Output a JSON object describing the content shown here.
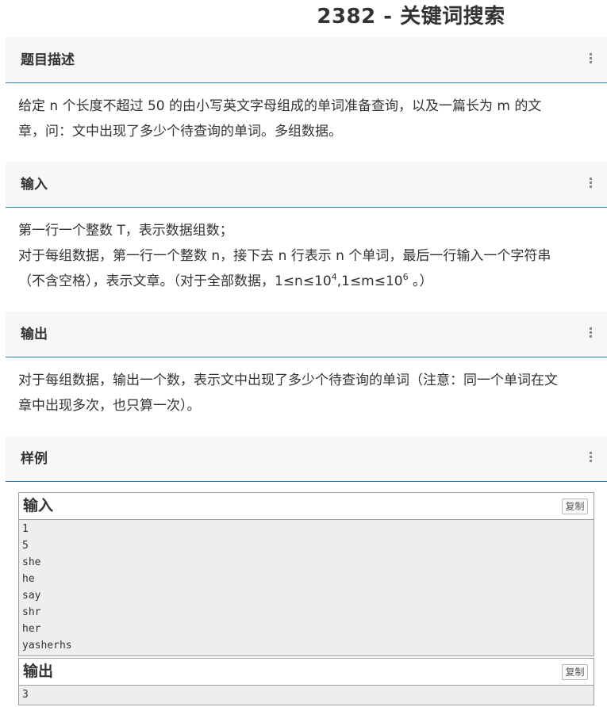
{
  "page": {
    "title": "2382 - 关键词搜索"
  },
  "sections": {
    "description": {
      "header": "题目描述",
      "lines": [
        "给定 n 个长度不超过 50 的由小写英文字母组成的单词准备查询，以及一篇长为 m 的文",
        "章，问：文中出现了多少个待查询的单词。多组数据。"
      ]
    },
    "input": {
      "header": "输入",
      "line1": "第一行一个整数 T，表示数据组数；",
      "line2": "对于每组数据，第一行一个整数 n，接下去 n 行表示 n 个单词，最后一行输入一个字符串",
      "line3_a": "（不含空格），表示文章。（对于全部数据，1≤n≤10",
      "line3_exp1": "4",
      "line3_b": ",1≤m≤10",
      "line3_exp2": "6",
      "line3_c": " 。）"
    },
    "output": {
      "header": "输出",
      "lines": [
        "对于每组数据，输出一个数，表示文中出现了多少个待查询的单词（注意：同一个单词在文",
        "章中出现多次，也只算一次）。"
      ]
    },
    "sample": {
      "header": "样例",
      "input_label": "输入",
      "input_text": "1\n5\nshe\nhe\nsay\nshr\nher\nyasherhs",
      "output_label": "输出",
      "output_text": "3",
      "copy_label": "复制"
    }
  },
  "icons": {
    "section_menu": "kebab-icon"
  },
  "colors": {
    "header_underline": "#2d7db8",
    "header_bg": "#f7f7f7",
    "sample_bg": "#eeeeee"
  }
}
